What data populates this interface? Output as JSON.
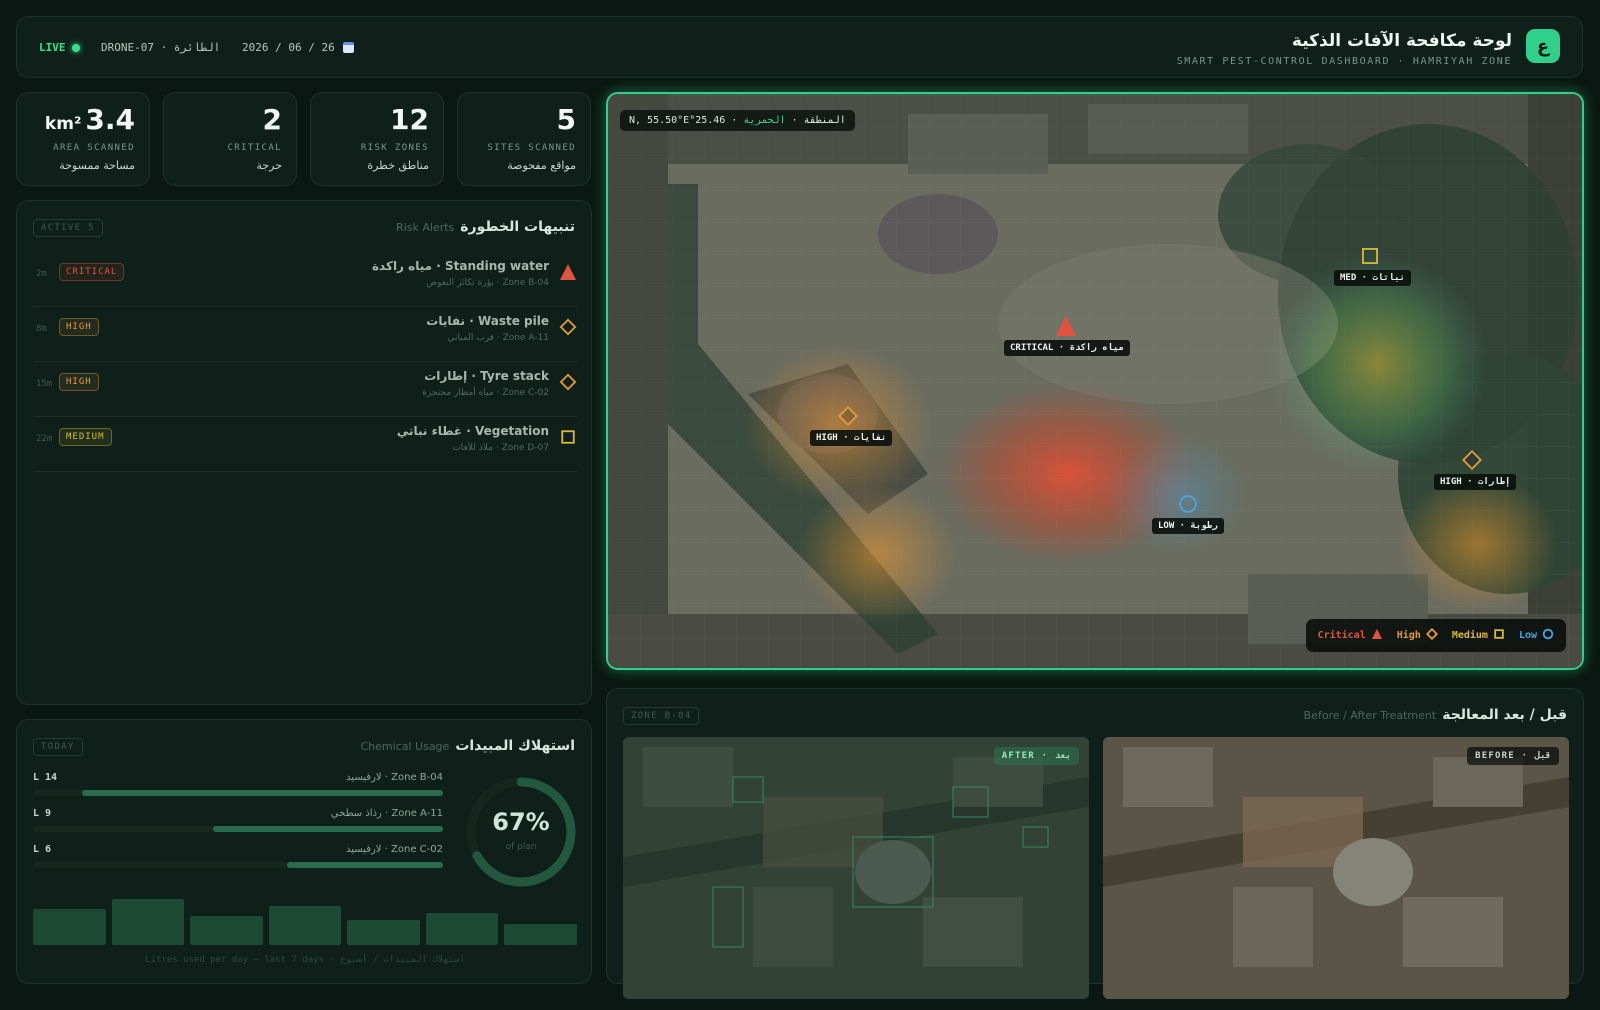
{
  "header": {
    "badge": "ع",
    "title_ar": "لوحة مكافحة الآفات الذكية",
    "title_en": "SMART PEST-CONTROL DASHBOARD · HAMRIYAH ZONE",
    "live": "LIVE",
    "drone": "DRONE-07 · الطائرة",
    "date": "2026 / 06 / 26"
  },
  "stats": [
    {
      "value": "5",
      "unit": "",
      "en": "SITES SCANNED",
      "ar": "مواقع مفحوصة"
    },
    {
      "value": "12",
      "unit": "",
      "en": "RISK ZONES",
      "ar": "مناطق خطرة"
    },
    {
      "value": "2",
      "unit": "",
      "en": "CRITICAL",
      "ar": "حرجة"
    },
    {
      "value": "3.4",
      "unit": "km²",
      "en": "AREA SCANNED",
      "ar": "مساحة ممسوحة"
    }
  ],
  "alerts": {
    "title_ar": "تنبيهات الخطورة",
    "title_en": "Risk Alerts",
    "chip": "ACTIVE 5",
    "items": [
      {
        "title": "Standing water · مياه راكدة",
        "desc": "Zone B-04 · بؤرة تكاثر البعوض",
        "severity": "CRITICAL",
        "age": "2m",
        "color": "#e2533f",
        "icon": "triangle"
      },
      {
        "title": "Waste pile · نفايات",
        "desc": "Zone A-11 · قرب المباني",
        "severity": "HIGH",
        "age": "8m",
        "color": "#e59a3a",
        "icon": "diamond"
      },
      {
        "title": "Tyre stack · إطارات",
        "desc": "Zone C-02 · مياه أمطار محتجزة",
        "severity": "HIGH",
        "age": "15m",
        "color": "#e59a3a",
        "icon": "diamond"
      },
      {
        "title": "Vegetation · غطاء نباتي",
        "desc": "Zone D-07 · ملاذ للآفات",
        "severity": "MEDIUM",
        "age": "22m",
        "color": "#d9b93c",
        "icon": "square"
      }
    ]
  },
  "chem": {
    "title_ar": "استهلاك المبيدات",
    "title_en": "Chemical Usage",
    "chip": "TODAY",
    "bars": [
      {
        "amount": "L 14",
        "zone": "Zone B-04 · لارفيسيد",
        "pct": 0.88
      },
      {
        "amount": "L 9",
        "zone": "Zone A-11 · رذاذ سطحي",
        "pct": 0.56
      },
      {
        "amount": "L 6",
        "zone": "Zone C-02 · لارفيسيد",
        "pct": 0.38
      }
    ],
    "donut_value": 0.67,
    "donut_label": "67%",
    "donut_sub": "of plan",
    "daily": [
      0.72,
      0.92,
      0.58,
      0.78,
      0.5,
      0.64,
      0.42
    ],
    "caption": "Litres used per day — last 7 days · استهلاك المبيدات / أسبوع"
  },
  "map": {
    "coord_prefix": "المنطقة · ",
    "coord_area": "الحمرية",
    "coord_value": " · N, 55.50°E°25.46",
    "markers": [
      {
        "label": "CRITICAL · مياه راكدة",
        "color": "#e2533f",
        "shape": "triangle"
      },
      {
        "label": "HIGH · نفايات",
        "color": "#e59a3a",
        "shape": "diamond"
      },
      {
        "label": "MED · نباتات",
        "color": "#d9b93c",
        "shape": "square"
      },
      {
        "label": "HIGH · إطارات",
        "color": "#e59a3a",
        "shape": "diamond"
      },
      {
        "label": "LOW · رطوبة",
        "color": "#4aa3df",
        "shape": "circle"
      }
    ],
    "legend": [
      {
        "label": "Critical",
        "color": "#e2533f",
        "shape": "triangle"
      },
      {
        "label": "High",
        "color": "#e59a3a",
        "shape": "diamond"
      },
      {
        "label": "Medium",
        "color": "#d9b93c",
        "shape": "square"
      },
      {
        "label": "Low",
        "color": "#4aa3df",
        "shape": "circle"
      }
    ]
  },
  "ba": {
    "title_ar": "قبل / بعد المعالجة",
    "title_en": "Before / After Treatment",
    "chip": "ZONE B-04",
    "after": "AFTER · بعد",
    "before": "BEFORE · قبل"
  }
}
